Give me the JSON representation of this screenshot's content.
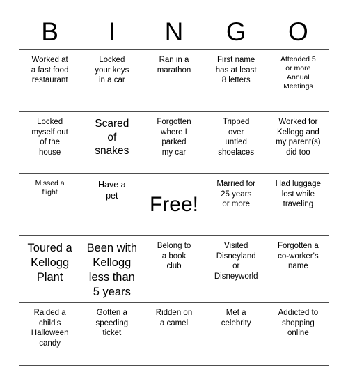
{
  "card": {
    "header_letters": [
      "B",
      "I",
      "N",
      "G",
      "O"
    ],
    "free_space_label": "Free!",
    "colors": {
      "background": "#ffffff",
      "text": "#000000",
      "grid_line": "#4d4d4d"
    },
    "rows": [
      [
        {
          "text": "Worked at\na fast food\nrestaurant",
          "size": "sm"
        },
        {
          "text": "Locked\nyour keys\nin a car",
          "size": "sm"
        },
        {
          "text": "Ran in a\nmarathon",
          "size": "sm"
        },
        {
          "text": "First name\nhas at least\n8 letters",
          "size": "sm"
        },
        {
          "text": "Attended 5\nor more\nAnnual\nMeetings",
          "size": "xs"
        }
      ],
      [
        {
          "text": "Locked\nmyself out\nof the\nhouse",
          "size": "sm"
        },
        {
          "text": "Scared\nof\nsnakes",
          "size": "lg"
        },
        {
          "text": "Forgotten\nwhere I\nparked\nmy car",
          "size": "sm"
        },
        {
          "text": "Tripped\nover\nuntied\nshoelaces",
          "size": "sm"
        },
        {
          "text": "Worked for\nKellogg and\nmy parent(s)\ndid too",
          "size": "sm"
        }
      ],
      [
        {
          "text": "Missed a\nflight",
          "size": "xs"
        },
        {
          "text": "Have a\npet",
          "size": "md"
        },
        {
          "text": "Free!",
          "size": "free"
        },
        {
          "text": "Married for\n25 years\nor more",
          "size": "sm"
        },
        {
          "text": "Had luggage\nlost while\ntraveling",
          "size": "sm"
        }
      ],
      [
        {
          "text": "Toured a\nKellogg\nPlant",
          "size": "xl"
        },
        {
          "text": "Been with\nKellogg\nless than\n5 years",
          "size": "xl"
        },
        {
          "text": "Belong to\na book\nclub",
          "size": "sm"
        },
        {
          "text": "Visited\nDisneyland\nor\nDisneyworld",
          "size": "sm"
        },
        {
          "text": "Forgotten a\nco-worker's\nname",
          "size": "sm"
        }
      ],
      [
        {
          "text": "Raided a\nchild's\nHalloween\ncandy",
          "size": "sm"
        },
        {
          "text": "Gotten a\nspeeding\nticket",
          "size": "sm"
        },
        {
          "text": "Ridden on\na camel",
          "size": "sm"
        },
        {
          "text": "Met a\ncelebrity",
          "size": "sm"
        },
        {
          "text": "Addicted to\nshopping\nonline",
          "size": "sm"
        }
      ]
    ]
  }
}
